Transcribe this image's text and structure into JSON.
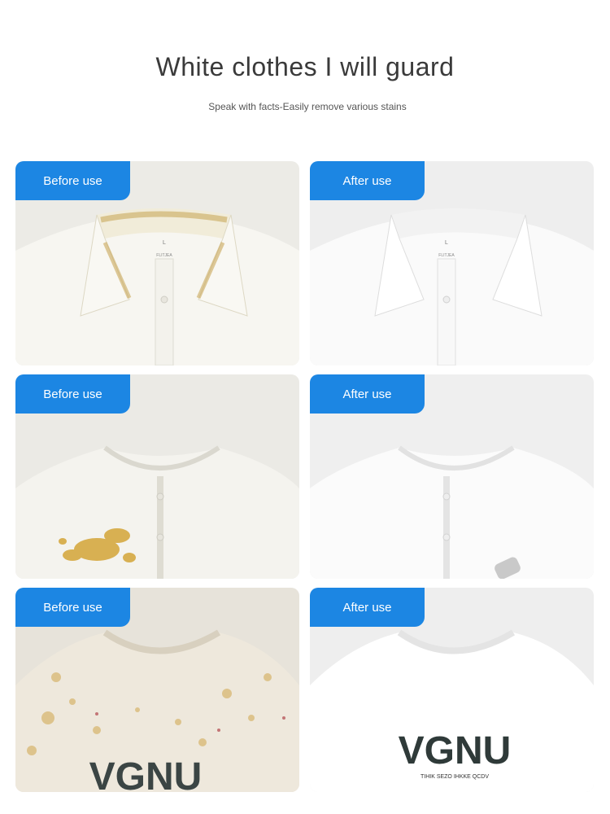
{
  "header": {
    "title": "White clothes I will guard",
    "subtitle": "Speak with facts-Easily remove various stains"
  },
  "colors": {
    "tab_blue": "#1c86e3"
  },
  "comparisons": [
    {
      "before_label": "Before use",
      "after_label": "After use",
      "garment": "collared shirt"
    },
    {
      "before_label": "Before use",
      "after_label": "After use",
      "garment": "round-neck cardigan"
    },
    {
      "before_label": "Before use",
      "after_label": "After use",
      "garment": "t-shirt"
    }
  ],
  "prints": {
    "shirt_label": "L",
    "shirt_label_brand": "FLITJEA",
    "tee_logo": "VGNU",
    "tee_tagline": "TIHIK SEZO IHKKE QCDV"
  }
}
